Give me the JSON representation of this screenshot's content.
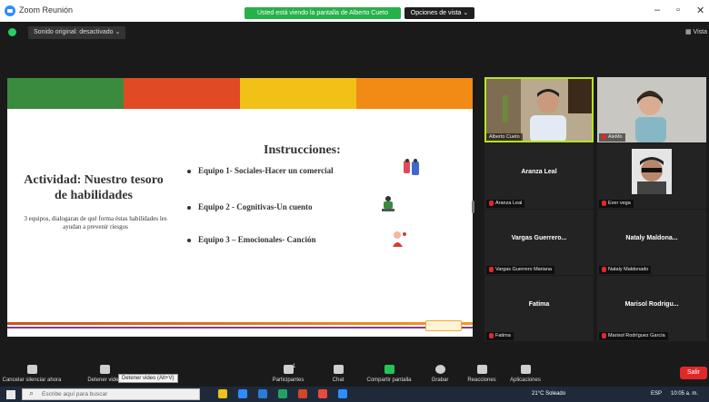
{
  "window": {
    "title": "Zoom Reunión",
    "share_banner": "Usted está viendo la pantalla de Alberto Cueto",
    "view_options": "Opciones de vista ⌄",
    "minimize": "–",
    "maximize": "▫",
    "close": "✕"
  },
  "meeting": {
    "original_sound": "Sonido original: desactivado ⌄",
    "view_label": "▦ Vista"
  },
  "slide": {
    "band_colors": [
      "#3a8b3d",
      "#e04a24",
      "#f2c117",
      "#f28a16"
    ],
    "activity_title": "Actividad: Nuestro tesoro de habilidades",
    "activity_desc": "3 equipos, dialogaran de qué forma éstas habilidades les ayudan a prevenir riesgos",
    "instructions_title": "Instrucciones:",
    "bullets": [
      "Equipo 1- Sociales-Hacer un comercial",
      "Equipo 2 - Cognitivas-Un cuento",
      "Equipo 3 – Emocionales- Canción"
    ]
  },
  "participants": [
    {
      "display": "",
      "label": "Alberto Cueto",
      "video": true,
      "active": true
    },
    {
      "display": "",
      "label": "AleMo",
      "video": true,
      "active": false
    },
    {
      "display": "Aranza Leal",
      "label": "Aranza Leal",
      "video": false,
      "active": false
    },
    {
      "display": "",
      "label": "Ever vega",
      "video": true,
      "active": false
    },
    {
      "display": "Vargas Guerrero...",
      "label": "Vargas Guerrero Mariana",
      "video": false,
      "active": false
    },
    {
      "display": "Nataly Maldona...",
      "label": "Nataly Maldonado",
      "video": false,
      "active": false
    },
    {
      "display": "Fatima",
      "label": "Fatima",
      "video": false,
      "active": false
    },
    {
      "display": "Marisol Rodrigu...",
      "label": "Marisol Rodríguez García",
      "video": false,
      "active": false
    }
  ],
  "toolbar": {
    "cancel_mute": "Cancelar silenciar ahora",
    "stop_video": "Detener video",
    "tooltip": "Detener video (Alt+V)",
    "participants": "Participantes",
    "participants_count": "1",
    "chat": "Chat",
    "share": "Compartir pantalla",
    "record": "Grabar",
    "reactions": "Reacciones",
    "apps": "Aplicaciones",
    "end": "Salir"
  },
  "taskbar": {
    "search_placeholder": "Escribe aquí para buscar",
    "weather": "21°C  Soleado",
    "language": "ESP",
    "time": "10:05 a. m."
  }
}
